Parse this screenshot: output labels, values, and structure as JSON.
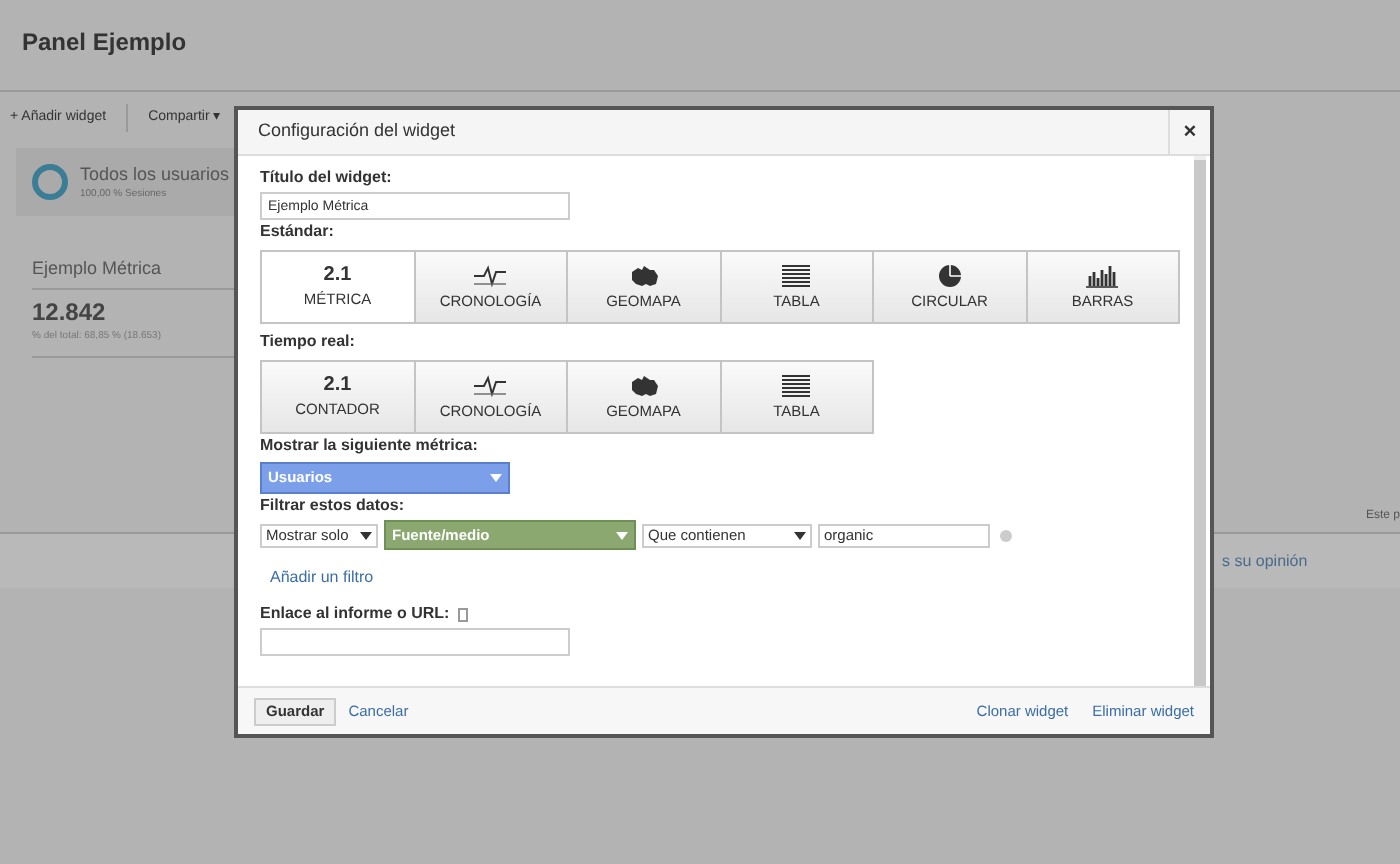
{
  "page": {
    "title": "Panel Ejemplo",
    "toolbar": [
      "+ Añadir widget",
      "Compartir ▾"
    ],
    "segment": {
      "name": "Todos los usuarios",
      "detail": "100,00 % Sesiones"
    },
    "widget": {
      "title": "Ejemplo Métrica",
      "value": "12.842",
      "detail": "% del total: 68,85 % (18.653)"
    },
    "side_text": "Este p",
    "feedback": "s su opinión"
  },
  "dialog": {
    "title": "Configuración del widget",
    "close": "×",
    "widget_title": {
      "label": "Título del widget:",
      "value": "Ejemplo Métrica"
    },
    "standard": {
      "label": "Estándar:",
      "options": [
        {
          "kind": "number",
          "glyph": "2.1",
          "label": "MÉTRICA",
          "selected": true
        },
        {
          "kind": "timeline",
          "label": "CRONOLOGÍA",
          "selected": false
        },
        {
          "kind": "map",
          "label": "GEOMAPA",
          "selected": false
        },
        {
          "kind": "table",
          "label": "TABLA",
          "selected": false
        },
        {
          "kind": "pie",
          "label": "CIRCULAR",
          "selected": false
        },
        {
          "kind": "bars",
          "label": "BARRAS",
          "selected": false
        }
      ]
    },
    "realtime": {
      "label": "Tiempo real:",
      "options": [
        {
          "kind": "number",
          "glyph": "2.1",
          "label": "CONTADOR",
          "selected": false
        },
        {
          "kind": "timeline",
          "label": "CRONOLOGÍA",
          "selected": false
        },
        {
          "kind": "map",
          "label": "GEOMAPA",
          "selected": false
        },
        {
          "kind": "table",
          "label": "TABLA",
          "selected": false
        }
      ]
    },
    "metric": {
      "label": "Mostrar la siguiente métrica:",
      "value": "Usuarios"
    },
    "filter": {
      "label": "Filtrar estos datos:",
      "mode": "Mostrar solo",
      "dimension": "Fuente/medio",
      "condition": "Que contienen",
      "value": "organic",
      "add": "Añadir un filtro"
    },
    "link": {
      "label": "Enlace al informe o URL:"
    },
    "footer": {
      "save": "Guardar",
      "cancel": "Cancelar",
      "clone": "Clonar widget",
      "delete": "Eliminar widget"
    }
  }
}
